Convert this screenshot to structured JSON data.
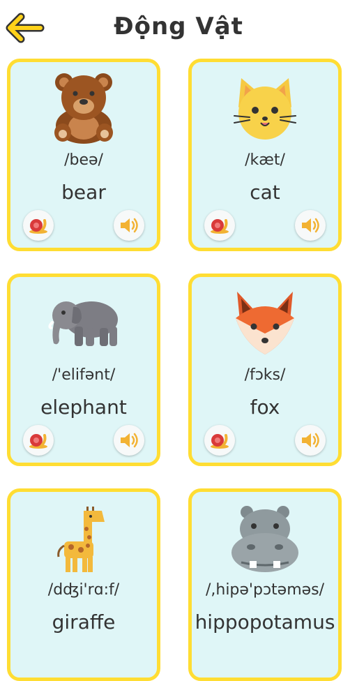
{
  "header": {
    "title": "Động Vật",
    "back_icon": "arrow-left-icon",
    "accent": "#ffd21a"
  },
  "cards": [
    {
      "ipa": "/beə/",
      "word": "bear",
      "icon": "bear-icon"
    },
    {
      "ipa": "/kæt/",
      "word": "cat",
      "icon": "cat-icon"
    },
    {
      "ipa": "/'elifənt/",
      "word": "elephant",
      "icon": "elephant-icon"
    },
    {
      "ipa": "/fɔks/",
      "word": "fox",
      "icon": "fox-icon"
    },
    {
      "ipa": "/dʤi'rɑ:f/",
      "word": "giraffe",
      "icon": "giraffe-icon"
    },
    {
      "ipa": "/,hipə'pɔtəməs/",
      "word": "hippopotamus",
      "icon": "hippo-icon"
    }
  ],
  "colors": {
    "card_bg": "#dff6f7",
    "card_border": "#ffdd33",
    "text": "#333333"
  }
}
